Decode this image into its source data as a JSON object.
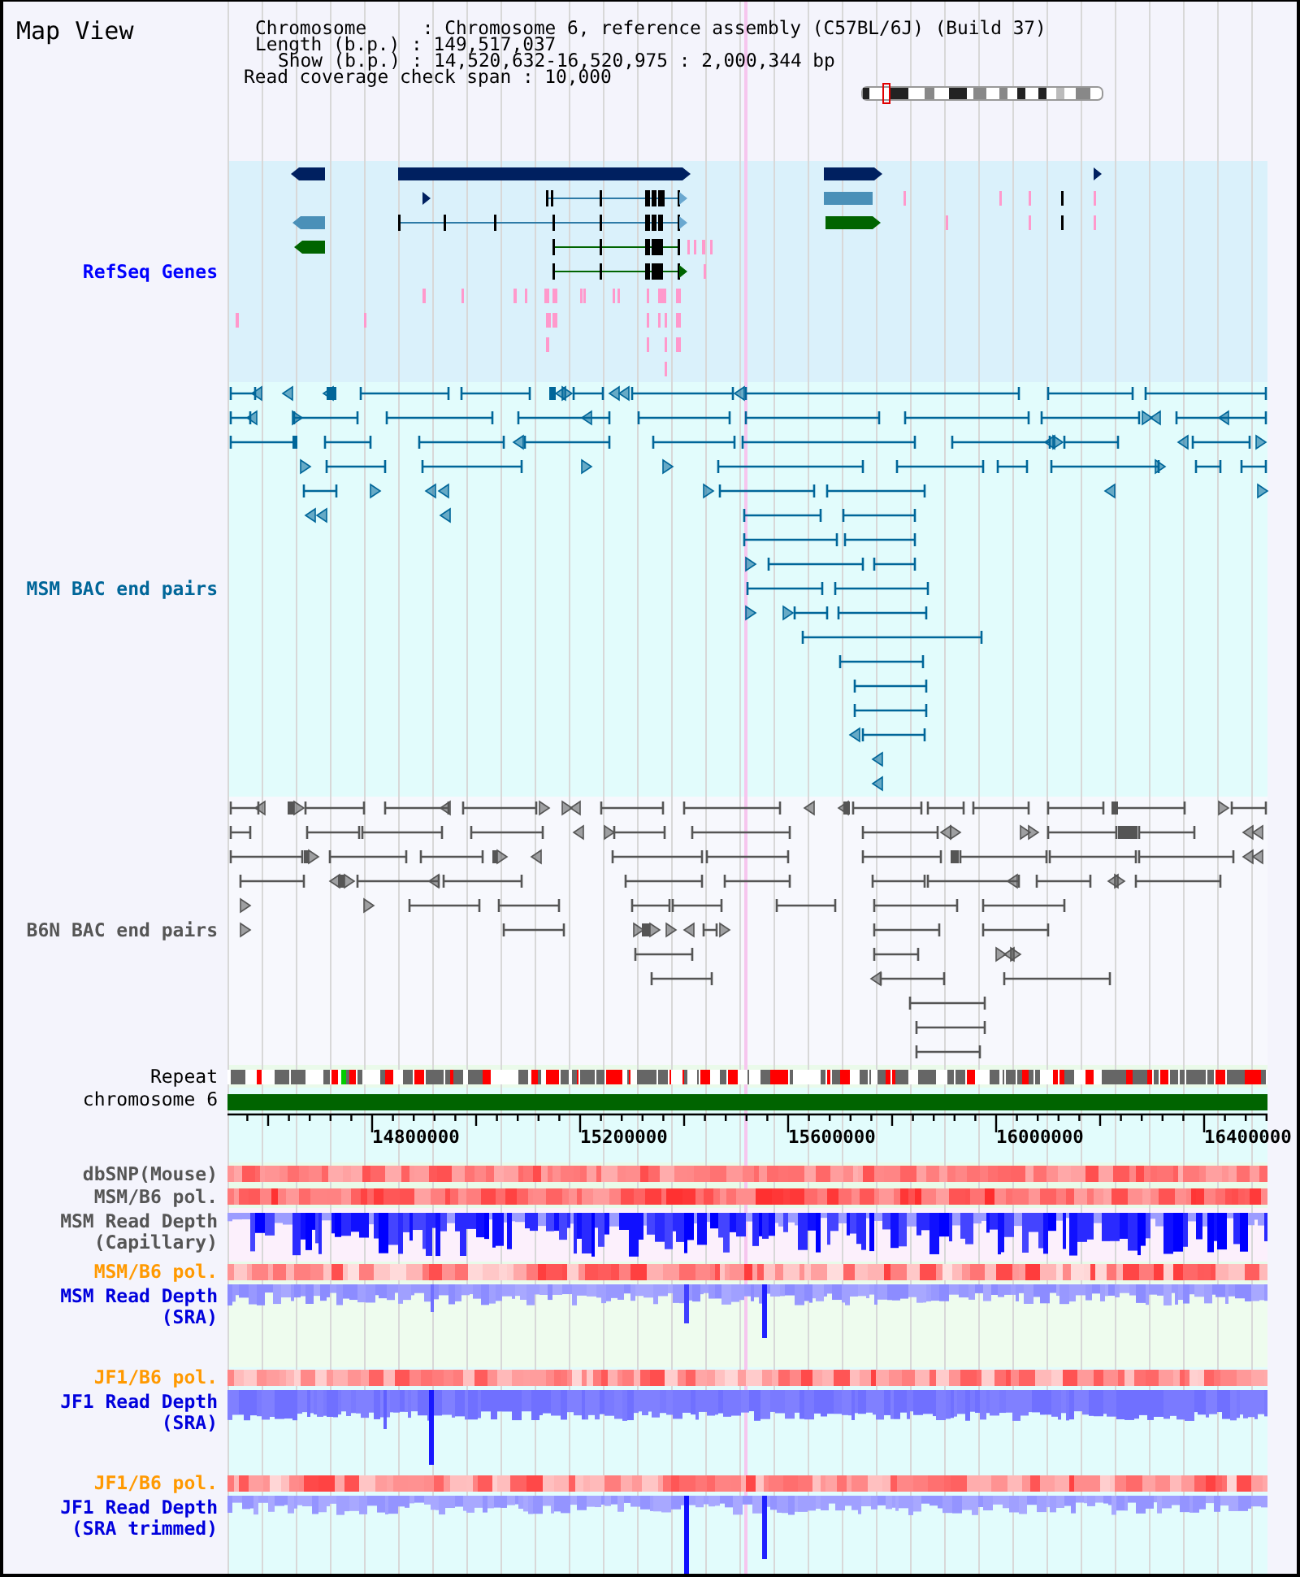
{
  "title": "Map View",
  "summary": [
    "Chromosome     : Chromosome 6, reference assembly (C57BL/6J) (Build 37)",
    "Length (b.p.) : 149,517,037",
    "Show (b.p.) : 14,520,632-16,520,975 : 2,000,344 bp",
    "Read coverage check span : 10,000"
  ],
  "tracks": [
    {
      "kind": "genes",
      "label": "RefSeq Genes",
      "color": "#0000ff"
    },
    {
      "kind": "bac_end_pairs",
      "label": "MSM BAC end pairs",
      "color": "#006699"
    },
    {
      "kind": "bac_end_pairs",
      "label": "B6N BAC end pairs",
      "color": "#555555"
    },
    {
      "kind": "repeat",
      "label": "Repeat",
      "color": "#000000"
    },
    {
      "kind": "chromosome",
      "label": "chromosome 6",
      "color": "#000000"
    },
    {
      "kind": "ruler",
      "ticks": [
        "14800000",
        "15200000",
        "15600000",
        "16000000",
        "16400000"
      ]
    },
    {
      "kind": "heatmap",
      "label": "dbSNP(Mouse)",
      "color": "#555555"
    },
    {
      "kind": "heatmap",
      "label": "MSM/B6 pol.",
      "color": "#555555"
    },
    {
      "kind": "read_depth",
      "label": "MSM Read Depth (Capillary)",
      "color": "#555555"
    },
    {
      "kind": "heatmap",
      "label": "MSM/B6 pol.",
      "color": "#ff9900"
    },
    {
      "kind": "read_depth",
      "label": "MSM Read Depth (SRA)",
      "color": "#0000dd"
    },
    {
      "kind": "heatmap",
      "label": "JF1/B6 pol.",
      "color": "#ff9900"
    },
    {
      "kind": "read_depth",
      "label": "JF1 Read Depth (SRA)",
      "color": "#0000dd"
    },
    {
      "kind": "heatmap",
      "label": "JF1/B6 pol.",
      "color": "#ff9900"
    },
    {
      "kind": "read_depth",
      "label": "JF1 Read Depth (SRA trimmed)",
      "color": "#0000dd"
    }
  ]
}
